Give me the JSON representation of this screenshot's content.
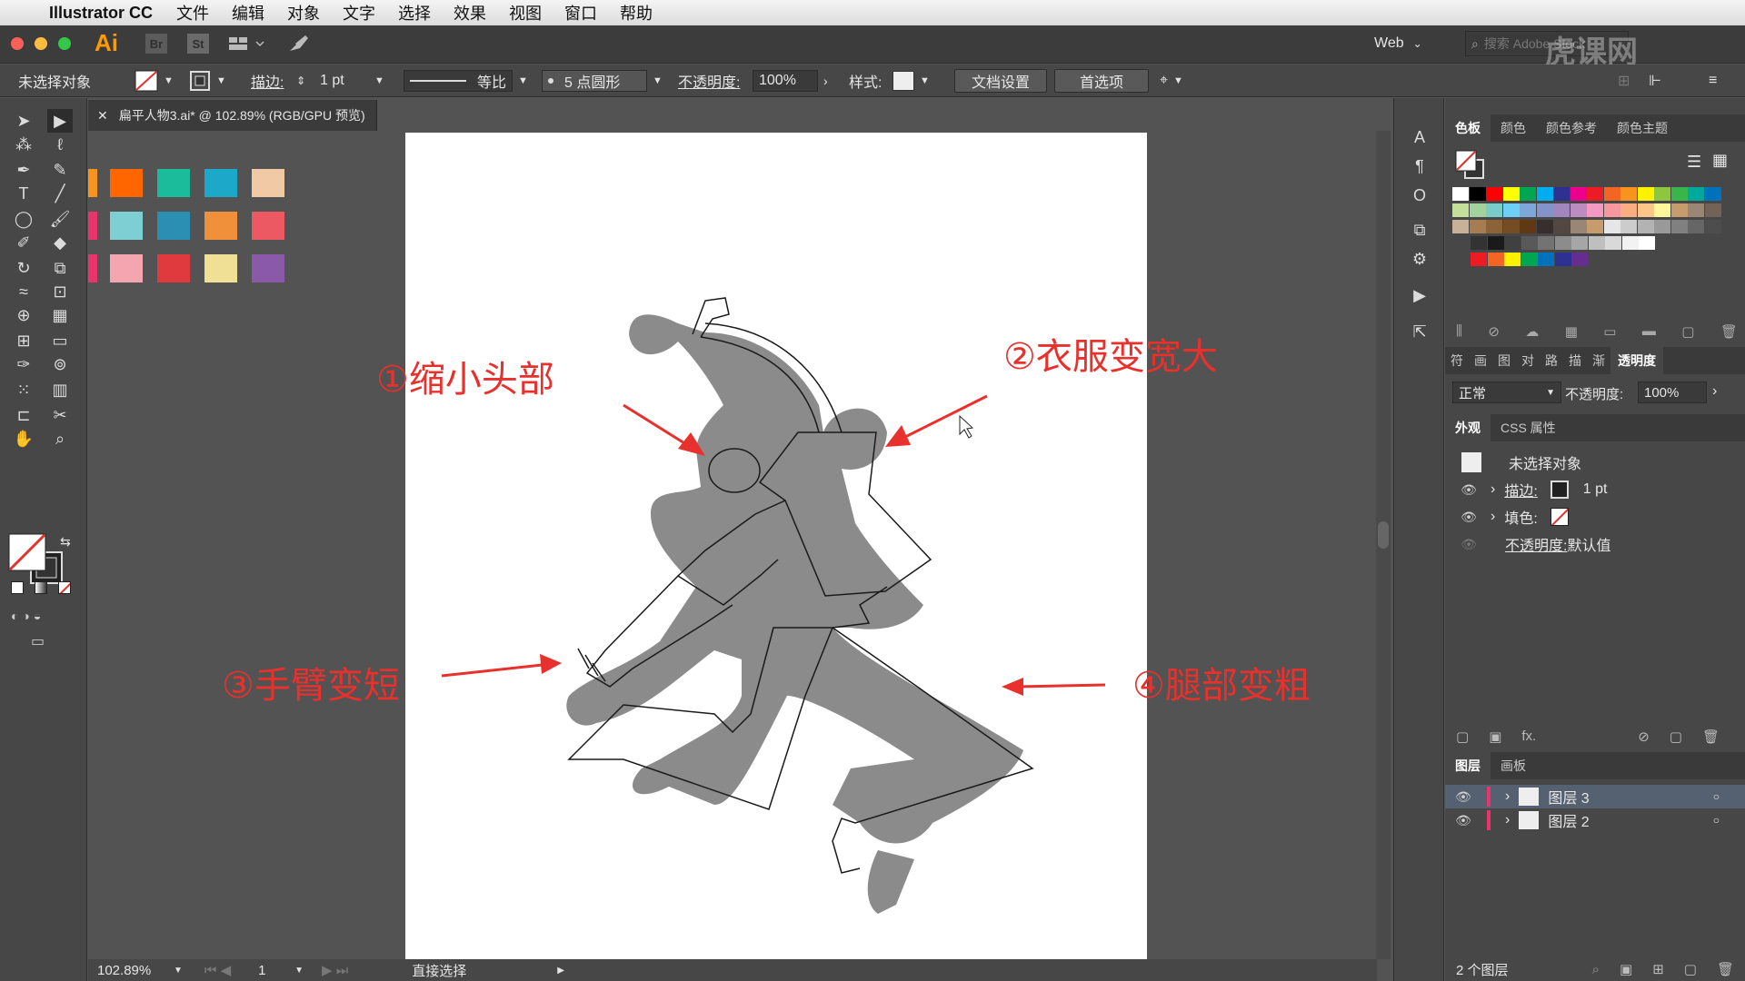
{
  "menubar": {
    "app_name": "Illustrator CC",
    "items": [
      "文件",
      "编辑",
      "对象",
      "文字",
      "选择",
      "效果",
      "视图",
      "窗口",
      "帮助"
    ]
  },
  "appbar": {
    "ai_logo": "Ai",
    "br_label": "Br",
    "st_label": "St",
    "workspace": "Web",
    "search_placeholder": "搜索 Adobe Stock",
    "watermark": "虎课网"
  },
  "control": {
    "selection_status": "未选择对象",
    "stroke_label": "描边:",
    "stroke_value": "1 pt",
    "profile_label": "等比",
    "brush_label": "5 点圆形",
    "opacity_label": "不透明度:",
    "opacity_value": "100%",
    "style_label": "样式:",
    "doc_setup": "文档设置",
    "preferences": "首选项"
  },
  "document": {
    "tab_title": "扁平人物3.ai* @ 102.89% (RGB/GPU 预览)",
    "zoom": "102.89%",
    "page": "1",
    "status_tool": "直接选择"
  },
  "canvas_swatches": [
    [
      "#f7941d",
      "#ff6600",
      "#1abc9c",
      "#1ca9c9",
      "#f2c9a5"
    ],
    [
      "#e8336d",
      "#7ecfd4",
      "#2a8fb3",
      "#f0903a",
      "#ec5962"
    ],
    [
      "#e8336d",
      "#f4a6b0",
      "#e0393e",
      "#f0e096",
      "#8a5aa8"
    ]
  ],
  "annotations": {
    "a1": "①缩小头部",
    "a2": "②衣服变宽大",
    "a3": "③手臂变短",
    "a4": "④腿部变粗"
  },
  "swatches_panel": {
    "tabs": [
      "色板",
      "颜色",
      "颜色参考",
      "颜色主题"
    ],
    "rows": [
      [
        "#ffffff",
        "#000000",
        "#ff0000",
        "#ffff00",
        "#00a651",
        "#00aeef",
        "#2e3192",
        "#ec008c",
        "#ed1c24",
        "#f26522",
        "#f7941d",
        "#fff200",
        "#8dc63f",
        "#39b54a",
        "#00a99d",
        "#0072bc"
      ],
      [
        "#c4df9b",
        "#a3d39c",
        "#7accc8",
        "#6dcff6",
        "#7da7d9",
        "#8393ca",
        "#a186be",
        "#bd8cbf",
        "#f49ac2",
        "#f6989d",
        "#f9ad81",
        "#fdc689",
        "#fff79a",
        "#c69c6d",
        "#998675",
        "#736357"
      ],
      [
        "#c7b299",
        "#a67c52",
        "#8c6239",
        "#754c24",
        "#603913",
        "#362f2d",
        "#534741",
        "#998675",
        "#c69c6d",
        "#e6e6e6",
        "#cccccc",
        "#b3b3b3",
        "#999999",
        "#808080",
        "#666666",
        "#4d4d4d"
      ],
      [
        "#333333",
        "#1a1a1a",
        "#404040",
        "#595959",
        "#737373",
        "#8c8c8c",
        "#a6a6a6",
        "#bfbfbf",
        "#d9d9d9",
        "#f2f2f2",
        "#ffffff"
      ],
      [
        "#ed1c24",
        "#f26522",
        "#fff200",
        "#00a651",
        "#0072bc",
        "#2e3192",
        "#662d91"
      ]
    ]
  },
  "transparency_panel": {
    "tabs": [
      "符",
      "画",
      "图",
      "对",
      "路",
      "描",
      "渐",
      "透明度"
    ],
    "mode": "正常",
    "opacity_label": "不透明度:",
    "opacity_value": "100%"
  },
  "appearance_panel": {
    "tabs": [
      "外观",
      "CSS 属性"
    ],
    "title": "未选择对象",
    "stroke_label": "描边:",
    "stroke_value": "1 pt",
    "fill_label": "填色:",
    "opacity_label": "不透明度:",
    "opacity_value": "默认值"
  },
  "layers_panel": {
    "tabs": [
      "图层",
      "画板"
    ],
    "layers": [
      {
        "name": "图层 3",
        "color": "#e8336d"
      },
      {
        "name": "图层 2",
        "color": "#e8336d"
      }
    ],
    "count": "2 个图层"
  }
}
